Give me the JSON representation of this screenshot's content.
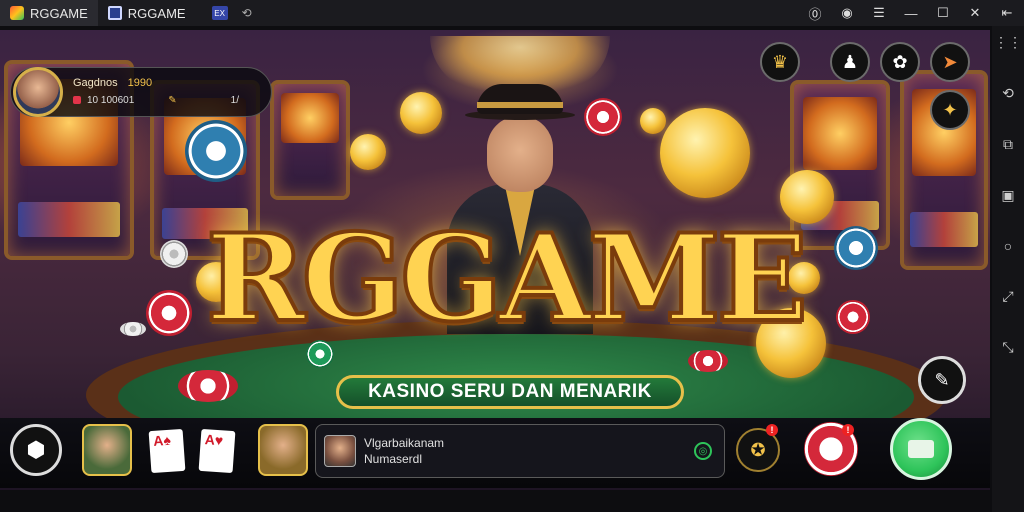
{
  "window": {
    "tabs": [
      {
        "title": "RGGAME",
        "active": true
      },
      {
        "title": "RGGAME",
        "active": false
      }
    ],
    "tab_mini_label": "EX",
    "toolbar_icons": [
      "refresh-icon",
      "account-icon",
      "record-icon",
      "menu-icon",
      "minimize-icon",
      "maximize-icon",
      "close-icon",
      "collapse-icon"
    ]
  },
  "side_rail": {
    "icons": [
      "grid-icon",
      "rotate-icon",
      "screenshot-icon",
      "multi-window-icon",
      "home-icon",
      "fullscreen-icon",
      "expand-icon"
    ]
  },
  "profile": {
    "name": "Gagdnos",
    "level": "1990",
    "stat_left": "10 100601",
    "stat_right": "1/"
  },
  "hero": {
    "logo": "RGGAME",
    "tagline": "KASINO SERU DAN MENARIK"
  },
  "top_right_buttons": [
    "trophy-icon",
    "player-icon",
    "settings-icon",
    "store-icon",
    "gift-icon"
  ],
  "bottom_bar": {
    "news_line1": "Vlgarbaikanam",
    "news_line2": "Numaserdl",
    "notification_badge_1": "!",
    "notification_badge_2": "!"
  },
  "colors": {
    "accent_gold": "#f2c24a",
    "felt_green": "#1b5a32",
    "cta_green": "#2ec45a",
    "chip_red": "#d4283a"
  }
}
